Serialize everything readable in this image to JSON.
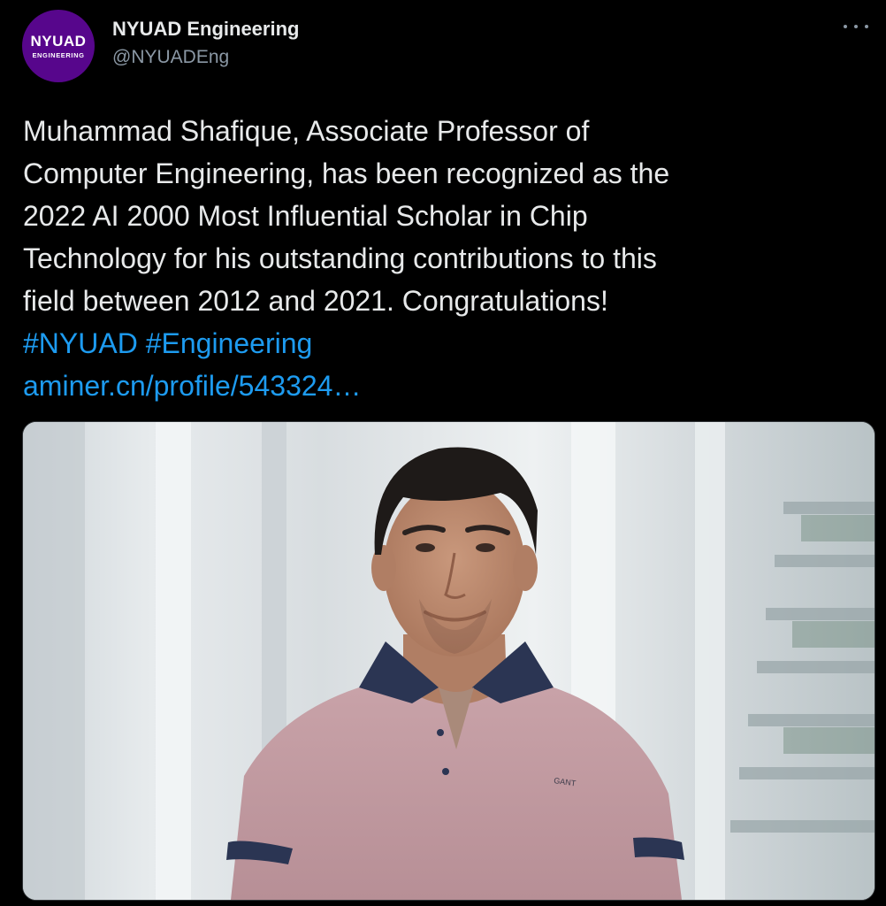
{
  "author": {
    "avatar_line1": "NYUAD",
    "avatar_line2": "ENGINEERING",
    "display_name": "NYUAD Engineering",
    "handle": "@NYUADEng",
    "avatar_color": "#57068c"
  },
  "tweet": {
    "lines": [
      "Muhammad Shafique, Associate Professor of",
      "Computer Engineering, has been recognized as the",
      "2022 AI 2000 Most Influential Scholar in Chip",
      "Technology for his outstanding contributions to this",
      "field between 2012 and 2021. Congratulations!"
    ],
    "hashtags": [
      "#NYUAD",
      "#Engineering"
    ],
    "link": "aminer.cn/profile/543324…"
  },
  "media": {
    "shirt_logo": "GANT"
  },
  "icons": {
    "more": "more-options-icon"
  },
  "colors": {
    "background": "#000000",
    "text": "#e7e9ea",
    "secondary": "#8b98a5",
    "link": "#1d9bf0"
  }
}
